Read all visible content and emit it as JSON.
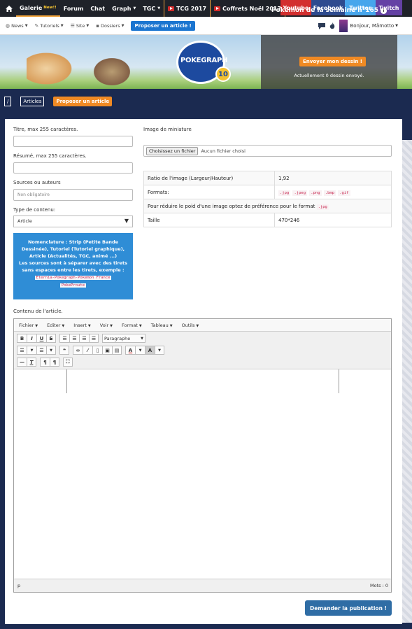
{
  "topnav": {
    "home_icon": "home-icon",
    "items": [
      {
        "label": "Galerie",
        "badge": "New!!"
      },
      {
        "label": "Forum"
      },
      {
        "label": "Chat"
      },
      {
        "label": "Graph"
      },
      {
        "label": "TGC"
      },
      {
        "label": "TCG 2017"
      },
      {
        "label": "Coffrets Noël 2017"
      }
    ],
    "social": {
      "youtube": "Youtube",
      "facebook": "Facebook",
      "twitter": "Twitter",
      "twitch": "Twitch"
    },
    "colors": {
      "youtube": "#d32f2f",
      "facebook": "#2e4b8f",
      "twitter": "#47a6ec",
      "twitch": "#6441a4",
      "accent": "#f0a23a"
    }
  },
  "subnav": {
    "news": "News",
    "tutoriels": "Tutoriels",
    "site": "Site",
    "dossiers": "Dossiers",
    "propose_button": "Proposer un article !",
    "greeting": "Bonjour, Mâmotto"
  },
  "banner": {
    "logo_text": "POKEGRAPH",
    "logo_badge": "10",
    "pokemon_title": "Pokémon de la semaine n°165",
    "send_drawing_button": "Envoyer mon dessin !",
    "drawing_count": "Actuellement 0 dessin envoyé."
  },
  "breadcrumb": {
    "root": "/",
    "articles": "Articles",
    "propose": "Proposer un article"
  },
  "form": {
    "title_label": "Titre, max 255 caractères.",
    "summary_label": "Résumé, max 255 caractères.",
    "sources_label": "Sources ou auteurs",
    "sources_placeholder": "Non obligatoire",
    "content_type_label": "Type de contenu:",
    "content_type_value": "Article",
    "info_line1": "Nomenclature : Strip (Petite Bande Dessinée), Tutoriel (Tutoriel graphique), Article (Actualités, TGC, animé ...)",
    "info_line2": "Les sources sont à séparer avec des tirets sans espaces entre les tirets, exemple :",
    "info_example_1": "Eternia-Pokegraph-Pokemon France",
    "info_example_2": "PokeProute",
    "thumbnail_label": "Image de miniature",
    "file_button": "Choisissez un fichier",
    "file_status": "Aucun fichier choisi",
    "content_label": "Contenu de l'article.",
    "submit_button": "Demander la publication !"
  },
  "image_info": {
    "ratio_label": "Ratio de l'image (Largeur/Hauteur)",
    "ratio_value": "1,92",
    "formats_label": "Formats:",
    "formats": [
      ".jpg",
      ".jpeg",
      ".png",
      ".bmp",
      ".gif"
    ],
    "tip_text": "Pour réduire le poid d'une image optez de préférence pour le format",
    "tip_format": ".jpg",
    "size_label": "Taille",
    "size_value": "470*246"
  },
  "editor": {
    "menus": [
      "Fichier",
      "Editer",
      "Insert",
      "Voir",
      "Format",
      "Tableau",
      "Outils"
    ],
    "format_select": "Paragraphe",
    "status_path": "p",
    "word_count": "Mots : 0"
  }
}
